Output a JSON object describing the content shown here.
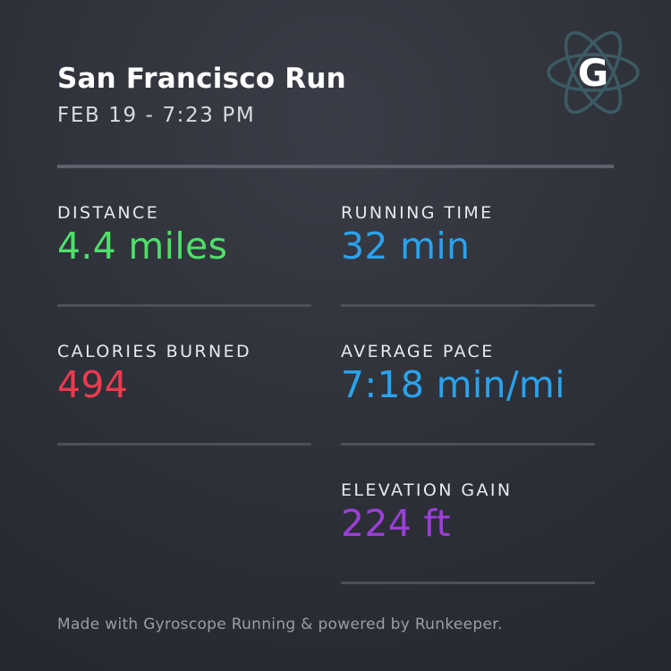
{
  "card": {
    "title": "San Francisco Run",
    "subtitle": "FEB 19 - 7:23 PM",
    "logo_letter": "G",
    "logo_icon": "gyroscope-atom-icon"
  },
  "stats": {
    "distance": {
      "label": "DISTANCE",
      "value": "4.4 miles",
      "color": "#4ee06a"
    },
    "running_time": {
      "label": "RUNNING TIME",
      "value": "32 min",
      "color": "#2aa3ee"
    },
    "calories": {
      "label": "CALORIES BURNED",
      "value": "494",
      "color": "#ee3a4f"
    },
    "average_pace": {
      "label": "AVERAGE PACE",
      "value": "7:18 min/mi",
      "color": "#2aa3ee"
    },
    "elevation": {
      "label": "ELEVATION GAIN",
      "value": "224 ft",
      "color": "#9b3fd8"
    }
  },
  "footer": "Made with Gyroscope Running & powered by Runkeeper."
}
